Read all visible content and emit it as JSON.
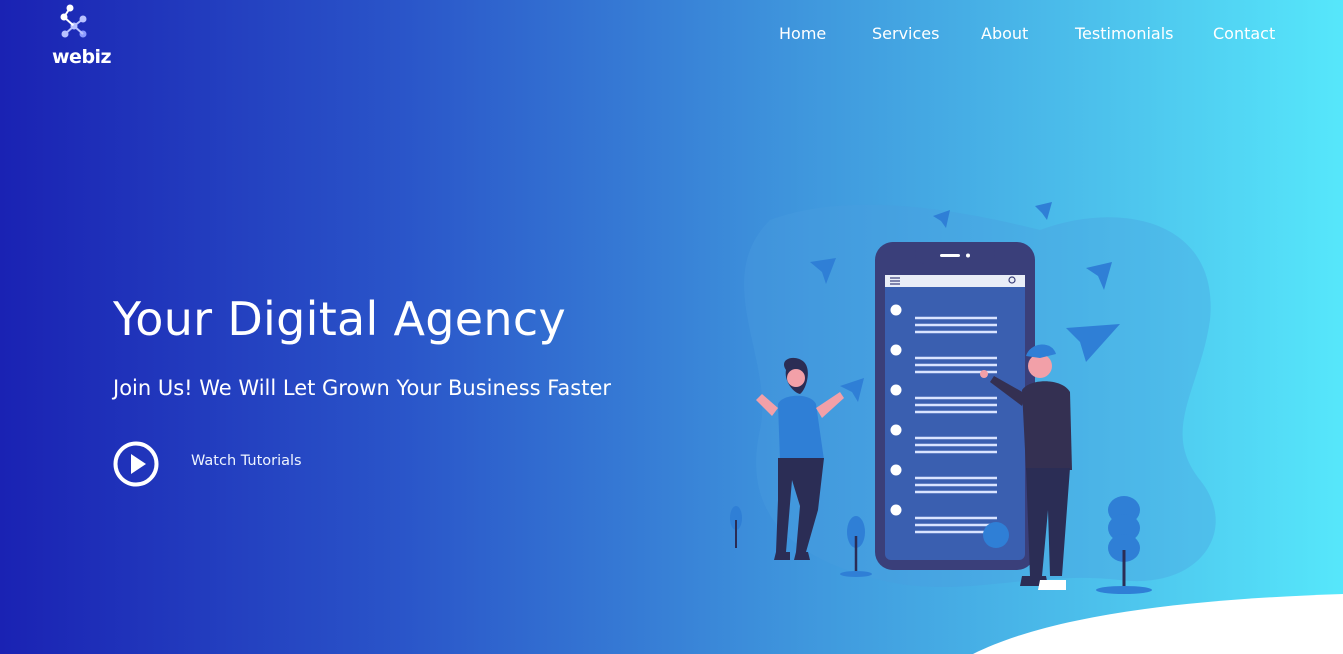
{
  "brand": {
    "logo_text": "webiz",
    "logo_icon": "molecule-logo-icon"
  },
  "nav": {
    "items": [
      {
        "label": "Home"
      },
      {
        "label": "Services"
      },
      {
        "label": "About"
      },
      {
        "label": "Testimonials"
      },
      {
        "label": "Contact"
      }
    ]
  },
  "hero": {
    "title": "Your Digital Agency",
    "subtitle": "Join Us! We Will Let Grown Your Business Faster",
    "cta_label": "Watch Tutorials",
    "cta_icon": "play-circle-icon"
  },
  "illustration": {
    "icon": "people-with-phone-illustration"
  },
  "colors": {
    "gradient_start": "#1a22b3",
    "gradient_end": "#56e7fb",
    "text": "#ffffff",
    "phone_body": "#3a3f7a",
    "phone_screen": "#3a5fb0"
  }
}
